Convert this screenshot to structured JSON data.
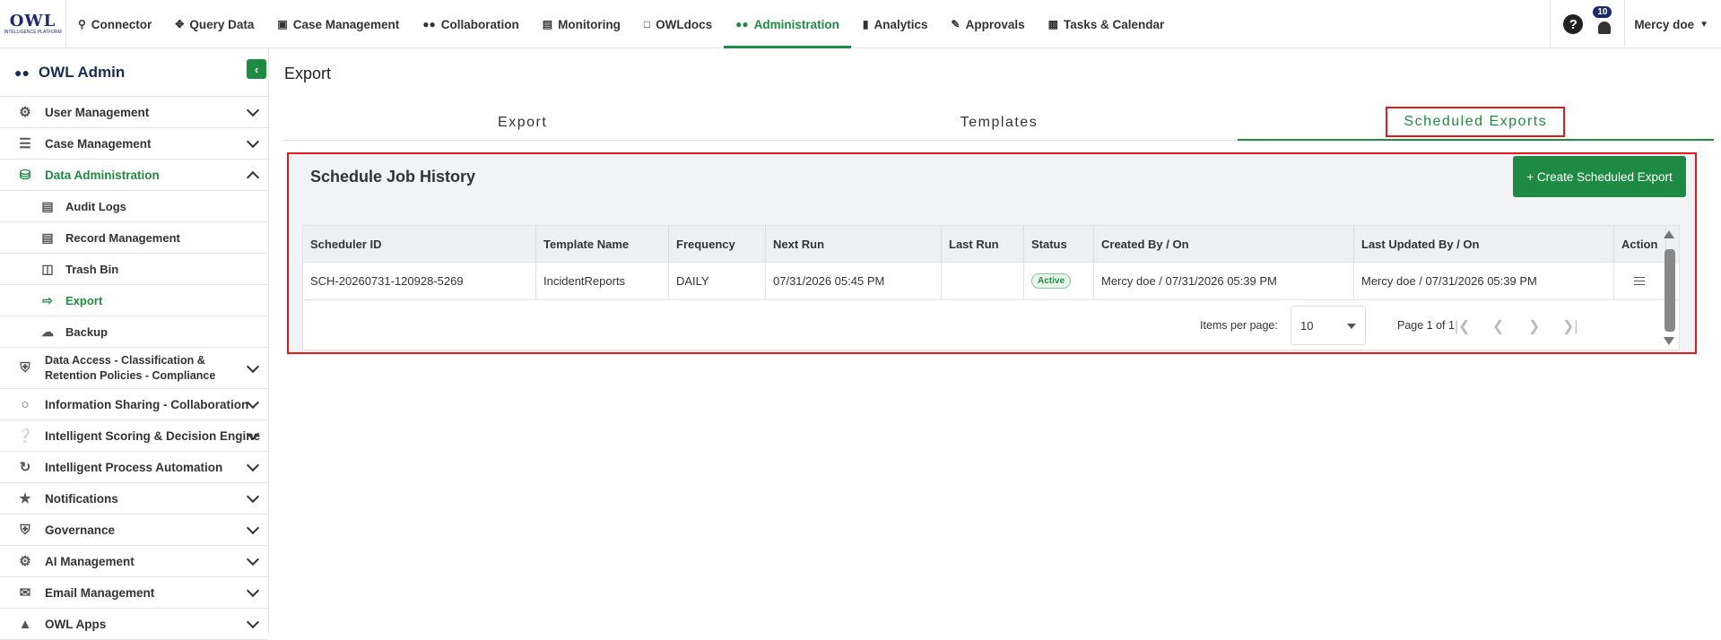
{
  "logo": {
    "main": "OWL",
    "sub": "INTELLIGENCE PLATFORM"
  },
  "nav": [
    {
      "label": "Connector",
      "icon": "search-icon"
    },
    {
      "label": "Query Data",
      "icon": "move-icon"
    },
    {
      "label": "Case Management",
      "icon": "case-icon"
    },
    {
      "label": "Collaboration",
      "icon": "people-icon"
    },
    {
      "label": "Monitoring",
      "icon": "monitor-icon"
    },
    {
      "label": "OWLdocs",
      "icon": "docs-icon"
    },
    {
      "label": "Administration",
      "icon": "admin-icon",
      "active": true
    },
    {
      "label": "Analytics",
      "icon": "analytics-icon"
    },
    {
      "label": "Approvals",
      "icon": "approvals-icon"
    },
    {
      "label": "Tasks & Calendar",
      "icon": "calendar-icon"
    }
  ],
  "top_right": {
    "help": "?",
    "notifications": "10",
    "user": "Mercy doe"
  },
  "sidebar": {
    "title": "OWL Admin",
    "items": [
      {
        "label": "User Management"
      },
      {
        "label": "Case Management"
      },
      {
        "label": "Data Administration",
        "expanded": true
      },
      {
        "label": "Audit Logs"
      },
      {
        "label": "Record Management"
      },
      {
        "label": "Trash Bin"
      },
      {
        "label": "Export",
        "active": true
      },
      {
        "label": "Backup"
      },
      {
        "label": "Data Access - Classification &",
        "label2": "Retention Policies - Compliance"
      },
      {
        "label": "Information Sharing - Collaboration"
      },
      {
        "label": "Intelligent Scoring & Decision Engine"
      },
      {
        "label": "Intelligent Process Automation"
      },
      {
        "label": "Notifications"
      },
      {
        "label": "Governance"
      },
      {
        "label": "AI Management"
      },
      {
        "label": "Email Management"
      },
      {
        "label": "OWL Apps"
      }
    ]
  },
  "page": {
    "title": "Export",
    "tabs": [
      "Export",
      "Templates",
      "Scheduled Exports"
    ],
    "active_tab": "Scheduled Exports"
  },
  "panel": {
    "title": "Schedule Job History",
    "create_button": "+ Create Scheduled Export"
  },
  "table": {
    "headers": [
      "Scheduler ID",
      "Template Name",
      "Frequency",
      "Next Run",
      "Last Run",
      "Status",
      "Created By / On",
      "Last Updated By / On",
      "Action"
    ],
    "rows": [
      [
        "SCH-20260731-120928-5269",
        "IncidentReports",
        "DAILY",
        "07/31/2026 05:45 PM",
        "",
        "Active",
        "Mercy doe / 07/31/2026 05:39 PM",
        "Mercy doe / 07/31/2026 05:39 PM",
        ""
      ]
    ]
  },
  "pager": {
    "items_per_page_label": "Items per page:",
    "items_per_page": "10",
    "page_info": "Page 1 of 1"
  },
  "colors": {
    "accent": "#1e8a43",
    "highlight": "#e01b1b",
    "brand": "#1b2a6b"
  }
}
